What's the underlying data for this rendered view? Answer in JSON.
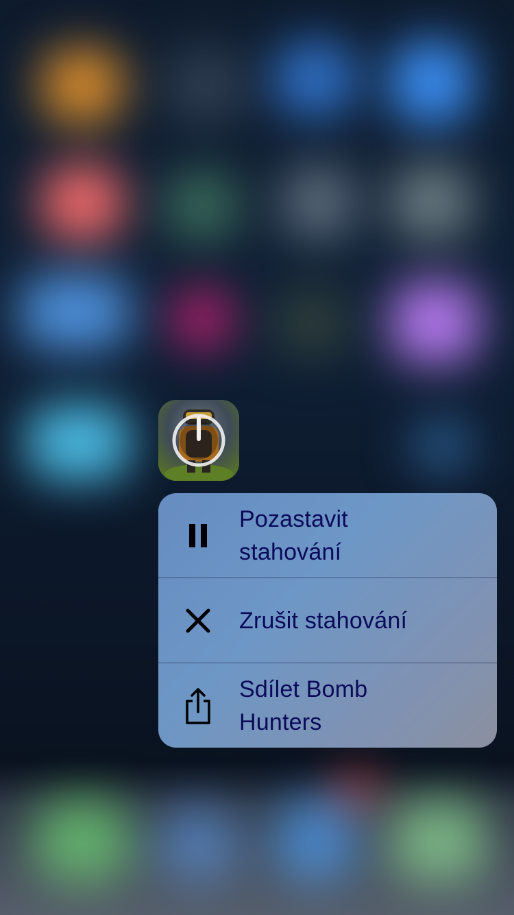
{
  "app": {
    "name": "Bomb Hunters",
    "state": "downloading"
  },
  "quick_actions": [
    {
      "icon": "pause-icon",
      "label_line1": "Pozastavit",
      "label_line2": "stahování"
    },
    {
      "icon": "close-icon",
      "label_line1": "Zrušit stahování",
      "label_line2": ""
    },
    {
      "icon": "share-icon",
      "label_line1": "Sdílet Bomb",
      "label_line2": "Hunters"
    }
  ],
  "colors": {
    "menu_text": "#0a0a5a",
    "menu_background": "#6f98cf"
  }
}
